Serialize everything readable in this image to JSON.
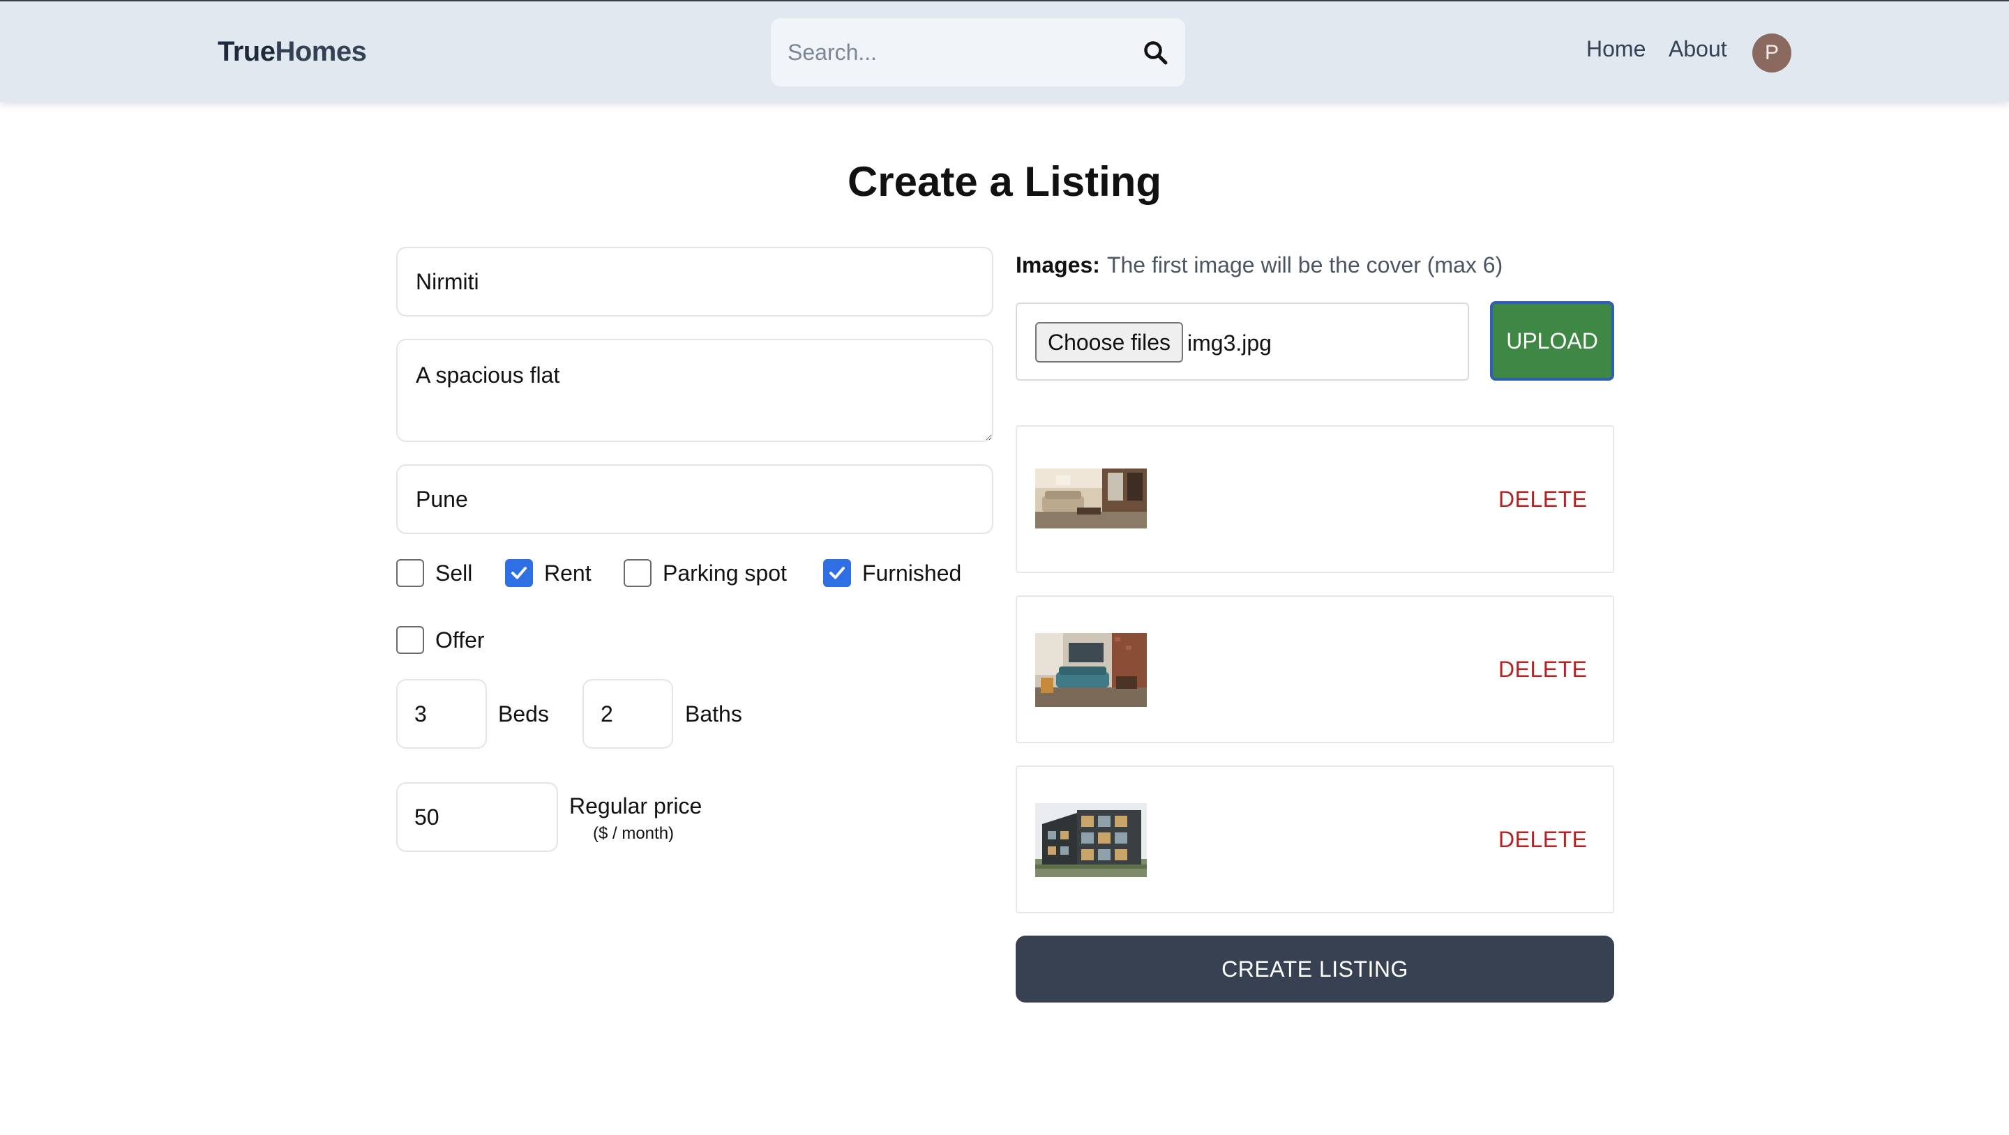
{
  "header": {
    "logo_part1": "True",
    "logo_part2": "Homes",
    "search_placeholder": "Search...",
    "nav_home": "Home",
    "nav_about": "About",
    "avatar_initial": "P"
  },
  "page": {
    "title": "Create a Listing"
  },
  "form": {
    "name_value": "Nirmiti",
    "description_value": "A spacious flat",
    "address_value": "Pune",
    "checkboxes": [
      {
        "label": "Sell",
        "checked": false
      },
      {
        "label": "Rent",
        "checked": true
      },
      {
        "label": "Parking spot",
        "checked": false
      },
      {
        "label": "Furnished",
        "checked": true
      },
      {
        "label": "Offer",
        "checked": false
      }
    ],
    "beds_value": "3",
    "beds_label": "Beds",
    "baths_value": "2",
    "baths_label": "Baths",
    "price_value": "50",
    "price_label": "Regular price",
    "price_sub_label": "($ / month)"
  },
  "images": {
    "heading": "Images:",
    "note": "The first image will be the cover (max 6)",
    "choose_button": "Choose files",
    "file_name": "img3.jpg",
    "upload_button": "UPLOAD",
    "delete_label": "DELETE",
    "uploaded": [
      {
        "thumb_icon": "living-room-thumbnail"
      },
      {
        "thumb_icon": "lounge-thumbnail"
      },
      {
        "thumb_icon": "building-exterior-thumbnail"
      }
    ]
  },
  "actions": {
    "create_button": "CREATE LISTING"
  },
  "colors": {
    "header_bg": "#e2e8f0",
    "upload_green": "#3f8744",
    "delete_red": "#b52222",
    "create_btn": "#374151",
    "checkbox_blue": "#2f6fe4"
  }
}
